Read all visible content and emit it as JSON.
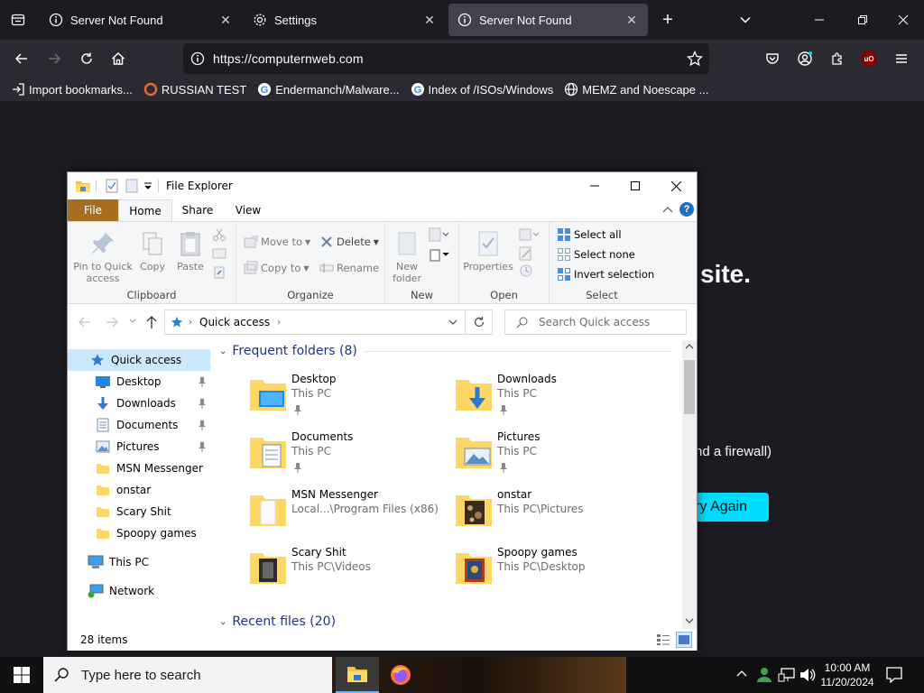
{
  "browser": {
    "tabs": [
      {
        "label": "Server Not Found",
        "close": "✕"
      },
      {
        "label": "Settings",
        "close": "✕"
      },
      {
        "label": "Server Not Found",
        "close": "✕"
      }
    ],
    "url": "https://computernweb.com",
    "bookmarks": [
      "Import bookmarks...",
      "RUSSIAN TEST",
      "Endermanch/Malware...",
      "Index of /ISOs/Windows",
      "MEMZ and Noescape ..."
    ],
    "extension_badge": "uO",
    "accent_color": "#00ddff"
  },
  "error_page": {
    "heading_fragment": "site.",
    "text_fragment": "nd a firewall)",
    "button_label": "ry Again"
  },
  "explorer": {
    "title": "File Explorer",
    "ribbon_tabs": [
      "File",
      "Home",
      "Share",
      "View"
    ],
    "clipboard": {
      "pin": "Pin to Quick access",
      "copy": "Copy",
      "paste": "Paste",
      "label": "Clipboard"
    },
    "organize": {
      "move_to": "Move to",
      "copy_to": "Copy to",
      "delete": "Delete",
      "rename": "Rename",
      "label": "Organize"
    },
    "new": {
      "new_folder": "New folder",
      "label": "New"
    },
    "open": {
      "properties": "Properties",
      "label": "Open"
    },
    "select": {
      "select_all": "Select all",
      "select_none": "Select none",
      "invert": "Invert selection",
      "label": "Select"
    },
    "address": "Quick access",
    "search_placeholder": "Search Quick access",
    "nav": [
      {
        "label": "Quick access"
      },
      {
        "label": "Desktop"
      },
      {
        "label": "Downloads"
      },
      {
        "label": "Documents"
      },
      {
        "label": "Pictures"
      },
      {
        "label": "MSN Messenger"
      },
      {
        "label": "onstar"
      },
      {
        "label": "Scary Shit"
      },
      {
        "label": "Spoopy games"
      },
      {
        "label": "This PC"
      },
      {
        "label": "Network"
      }
    ],
    "frequent_header": "Frequent folders (8)",
    "recent_header": "Recent files (20)",
    "folders": [
      {
        "name": "Desktop",
        "path": "This PC"
      },
      {
        "name": "Downloads",
        "path": "This PC"
      },
      {
        "name": "Documents",
        "path": "This PC"
      },
      {
        "name": "Pictures",
        "path": "This PC"
      },
      {
        "name": "MSN Messenger",
        "path": "Local...\\Program Files (x86)"
      },
      {
        "name": "onstar",
        "path": "This PC\\Pictures"
      },
      {
        "name": "Scary Shit",
        "path": "This PC\\Videos"
      },
      {
        "name": "Spoopy games",
        "path": "This PC\\Desktop"
      }
    ],
    "status": "28 items"
  },
  "taskbar": {
    "search_placeholder": "Type here to search",
    "time": "10:00 AM",
    "date": "11/20/2024"
  }
}
